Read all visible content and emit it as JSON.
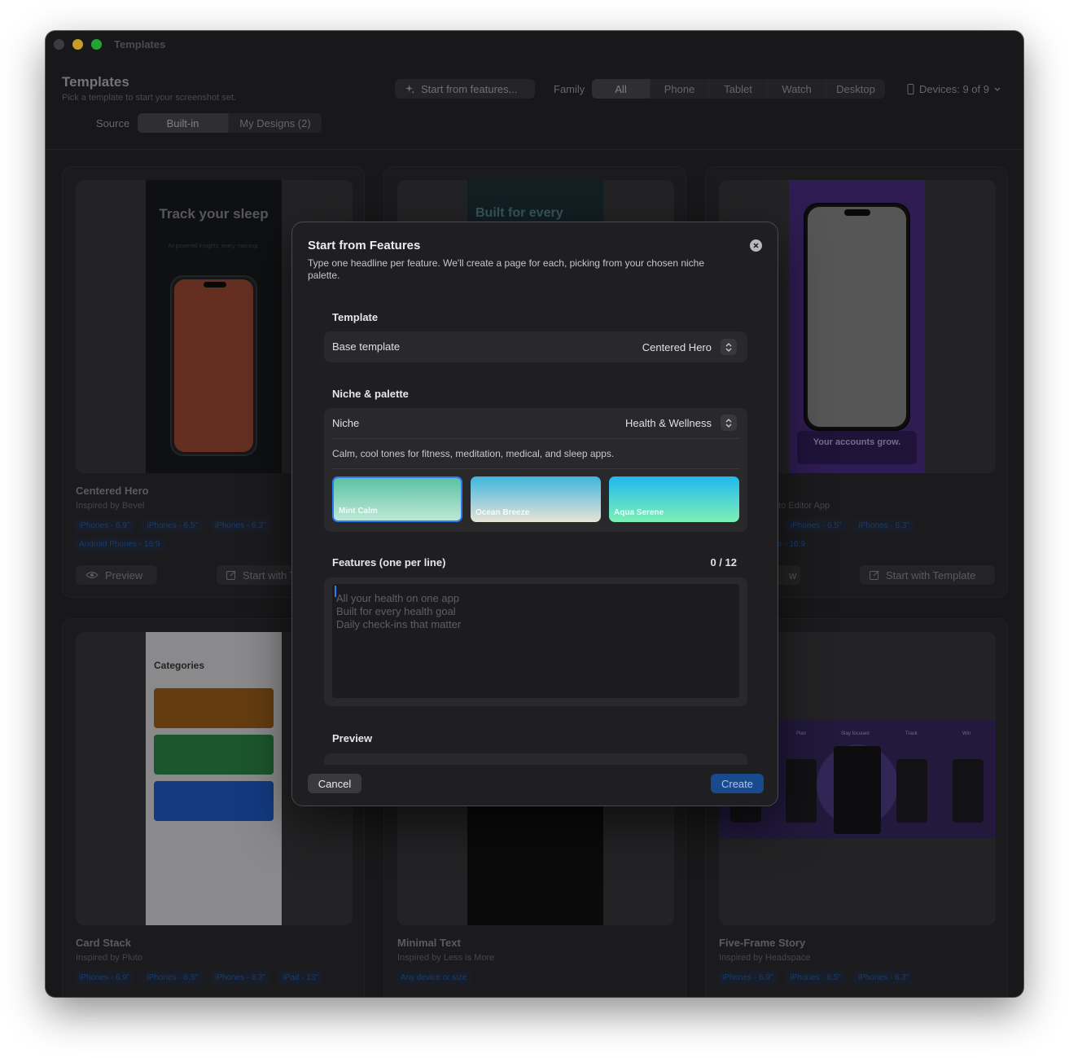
{
  "window": {
    "title": "Templates"
  },
  "header": {
    "title": "Templates",
    "subtitle": "Pick a template to start your screenshot set.",
    "start_features_label": "Start from features...",
    "family_label": "Family",
    "family_options": [
      "All",
      "Phone",
      "Tablet",
      "Watch",
      "Desktop"
    ],
    "family_selected": "All",
    "devices_label": "Devices: 9 of 9",
    "source_label": "Source",
    "source_options": [
      "Built-in",
      "My Designs (2)"
    ],
    "source_selected": "Built-in"
  },
  "cards": [
    {
      "name": "Centered Hero",
      "inspired": "Inspired by Bevel",
      "headline": "Track your sleep",
      "caption": "AI-powered insights, every morning.",
      "tags": [
        "iPhones - 6.9\"",
        "iPhones - 6.5\"",
        "iPhones - 6.3\"",
        "Android Phones - 16:9"
      ],
      "preview_label": "Preview",
      "start_label": "Start with Template"
    },
    {
      "headline": "Built for every"
    },
    {
      "name": "Photo Editor App",
      "partial_name": "oto Editor App",
      "headline": "Your accounts grow.",
      "tags": [
        "iPhones - 6.5\"",
        "iPhones - 6.3\"",
        "es - 16:9"
      ],
      "partial_preview": "w",
      "start_label": "Start with Template"
    },
    {
      "name": "Card Stack",
      "inspired": "Inspired by Pluto",
      "headline": "Categories",
      "tags": [
        "iPhones - 6.9\"",
        "iPhones - 6.5\"",
        "iPhones - 6.3\"",
        "iPad - 13\""
      ]
    },
    {
      "name": "Minimal Text",
      "inspired": "Inspired by Less is More",
      "tags": [
        "Any device or size"
      ]
    },
    {
      "name": "Five-Frame Story",
      "inspired": "Inspired by Headspace",
      "frames": [
        "Plan",
        "Stay focused",
        "Track",
        "Win"
      ],
      "tags": [
        "iPhones - 6.9\"",
        "iPhones - 6.5\"",
        "iPhones - 6.3\""
      ]
    }
  ],
  "modal": {
    "title": "Start from Features",
    "description": "Type one headline per feature. We'll create a page for each, picking from your chosen niche palette.",
    "template_section": "Template",
    "base_template_label": "Base template",
    "base_template_value": "Centered Hero",
    "niche_section": "Niche & palette",
    "niche_label": "Niche",
    "niche_value": "Health & Wellness",
    "niche_description": "Calm, cool tones for fitness, meditation, medical, and sleep apps.",
    "palettes": [
      {
        "name": "Mint Calm",
        "selected": true,
        "colors": [
          "#5ac2a2",
          "#bfe8d8"
        ]
      },
      {
        "name": "Ocean Breeze",
        "selected": false,
        "colors": [
          "#3fb6dd",
          "#e9e3d6"
        ]
      },
      {
        "name": "Aqua Serene",
        "selected": false,
        "colors": [
          "#1fb8f0",
          "#7ff0b4"
        ]
      }
    ],
    "features_section": "Features (one per line)",
    "features_count": "0 / 12",
    "features_placeholder_lines": [
      "All your health on one app",
      "Built for every health goal",
      "Daily check-ins that matter"
    ],
    "preview_section": "Preview",
    "cancel_label": "Cancel",
    "create_label": "Create"
  },
  "colors": {
    "accent": "#2d7cf6",
    "create_button": "#1a4a8e"
  }
}
